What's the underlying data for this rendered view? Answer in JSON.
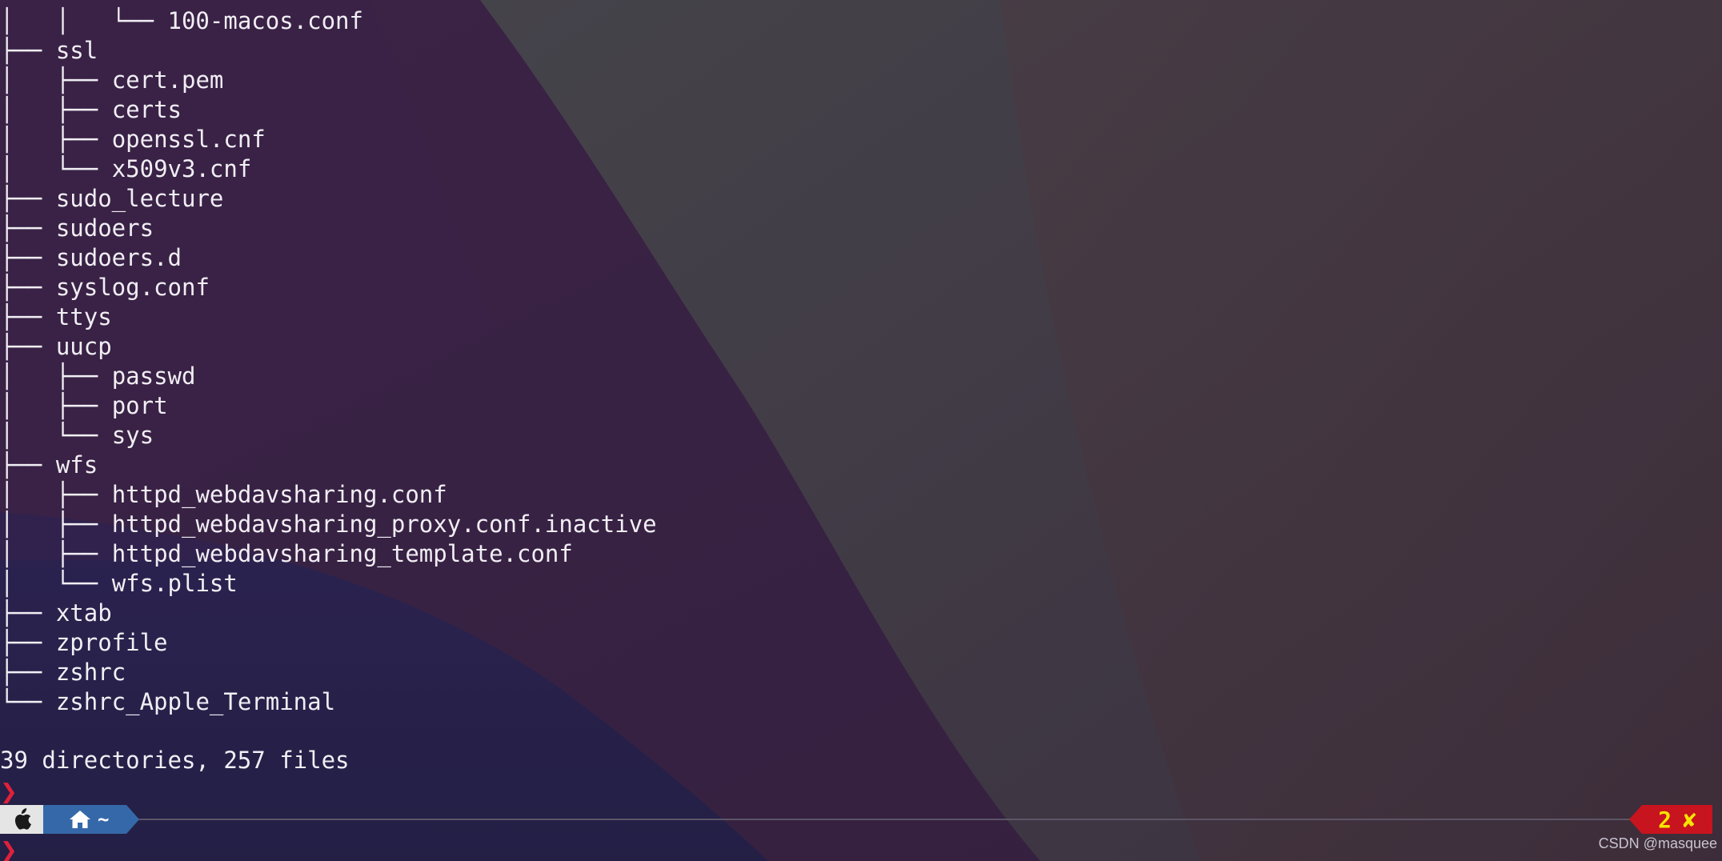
{
  "tree": [
    {
      "prefix": "│   │   └── ",
      "name": "100-macos.conf"
    },
    {
      "prefix": "├── ",
      "name": "ssl"
    },
    {
      "prefix": "│   ├── ",
      "name": "cert.pem"
    },
    {
      "prefix": "│   ├── ",
      "name": "certs"
    },
    {
      "prefix": "│   ├── ",
      "name": "openssl.cnf"
    },
    {
      "prefix": "│   └── ",
      "name": "x509v3.cnf"
    },
    {
      "prefix": "├── ",
      "name": "sudo_lecture"
    },
    {
      "prefix": "├── ",
      "name": "sudoers"
    },
    {
      "prefix": "├── ",
      "name": "sudoers.d"
    },
    {
      "prefix": "├── ",
      "name": "syslog.conf"
    },
    {
      "prefix": "├── ",
      "name": "ttys"
    },
    {
      "prefix": "├── ",
      "name": "uucp"
    },
    {
      "prefix": "│   ├── ",
      "name": "passwd"
    },
    {
      "prefix": "│   ├── ",
      "name": "port"
    },
    {
      "prefix": "│   └── ",
      "name": "sys"
    },
    {
      "prefix": "├── ",
      "name": "wfs"
    },
    {
      "prefix": "│   ├── ",
      "name": "httpd_webdavsharing.conf"
    },
    {
      "prefix": "│   ├── ",
      "name": "httpd_webdavsharing_proxy.conf.inactive"
    },
    {
      "prefix": "│   ├── ",
      "name": "httpd_webdavsharing_template.conf"
    },
    {
      "prefix": "│   └── ",
      "name": "wfs.plist"
    },
    {
      "prefix": "├── ",
      "name": "xtab"
    },
    {
      "prefix": "├── ",
      "name": "zprofile"
    },
    {
      "prefix": "├── ",
      "name": "zshrc"
    },
    {
      "prefix": "└── ",
      "name": "zshrc_Apple_Terminal"
    }
  ],
  "summary": "39 directories, 257 files",
  "prompt": {
    "symbol": "❯",
    "color": "#e0203a"
  },
  "statusbar": {
    "os_icon": "apple-icon",
    "home_icon": "home-icon",
    "path": "~",
    "exit_code": "2",
    "error_icon": "cross-icon",
    "error_glyph": "✘",
    "apple_segment_color": "#e5e5e5",
    "path_segment_color": "#3568a8",
    "status_segment_color": "#c8141e",
    "status_text_color": "#f5e500"
  },
  "watermark": "CSDN @masquee"
}
